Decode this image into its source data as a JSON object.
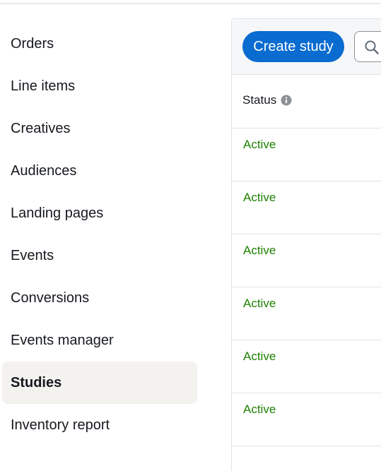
{
  "sidebar": {
    "items": [
      {
        "label": "Orders",
        "active": false
      },
      {
        "label": "Line items",
        "active": false
      },
      {
        "label": "Creatives",
        "active": false
      },
      {
        "label": "Audiences",
        "active": false
      },
      {
        "label": "Landing pages",
        "active": false
      },
      {
        "label": "Events",
        "active": false
      },
      {
        "label": "Conversions",
        "active": false
      },
      {
        "label": "Events manager",
        "active": false
      },
      {
        "label": "Studies",
        "active": true
      },
      {
        "label": "Inventory report",
        "active": false
      }
    ]
  },
  "toolbar": {
    "create_label": "Create study",
    "search_icon": "search-icon"
  },
  "table": {
    "columns": [
      {
        "label": "Status",
        "icon": "info-icon"
      }
    ],
    "rows": [
      {
        "status": "Active"
      },
      {
        "status": "Active"
      },
      {
        "status": "Active"
      },
      {
        "status": "Active"
      },
      {
        "status": "Active"
      },
      {
        "status": "Active"
      }
    ]
  },
  "colors": {
    "primary_button": "#0a6bd0",
    "status_active": "#1d8102",
    "active_nav_bg": "#f3f2ef"
  }
}
